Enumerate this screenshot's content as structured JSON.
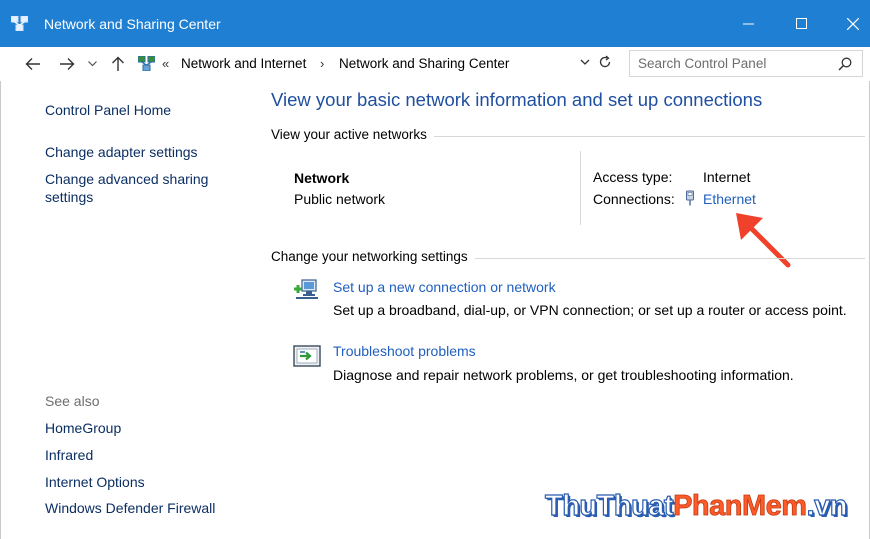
{
  "window": {
    "title": "Network and Sharing Center",
    "titlebar_color": "#1f7fd2"
  },
  "address_bar": {
    "back_icon": "back-arrow-icon",
    "forward_icon": "forward-arrow-icon",
    "recent_icon": "chevron-down-icon",
    "up_icon": "up-arrow-icon",
    "overflow": "«",
    "crumbs": [
      "Network and Internet",
      "Network and Sharing Center"
    ],
    "separator": "›",
    "search_placeholder": "Search Control Panel"
  },
  "sidebar": {
    "home": "Control Panel Home",
    "links": [
      "Change adapter settings",
      "Change advanced sharing settings"
    ],
    "see_also_label": "See also",
    "see_also": [
      "HomeGroup",
      "Infrared",
      "Internet Options",
      "Windows Defender Firewall"
    ]
  },
  "main": {
    "title": "View your basic network information and set up connections",
    "active_networks_heading": "View your active networks",
    "network": {
      "name": "Network",
      "type": "Public network",
      "access_type_label": "Access type:",
      "access_type_value": "Internet",
      "connections_label": "Connections:",
      "connection_name": "Ethernet"
    },
    "settings_heading": "Change your networking settings",
    "tasks": [
      {
        "link": "Set up a new connection or network",
        "description": "Set up a broadband, dial-up, or VPN connection; or set up a router or access point.",
        "icon": "new-connection-icon"
      },
      {
        "link": "Troubleshoot problems",
        "description": "Diagnose and repair network problems, or get troubleshooting information.",
        "icon": "troubleshoot-icon"
      }
    ]
  },
  "annotation": {
    "arrow_color": "#f0412b"
  },
  "watermark": {
    "part1": "ThuThuat",
    "part2": "PhanMem",
    "part3": ".vn"
  },
  "colors": {
    "link": "#1f5fbf",
    "nav_link": "#0b2e63",
    "title": "#1f4fa0"
  }
}
